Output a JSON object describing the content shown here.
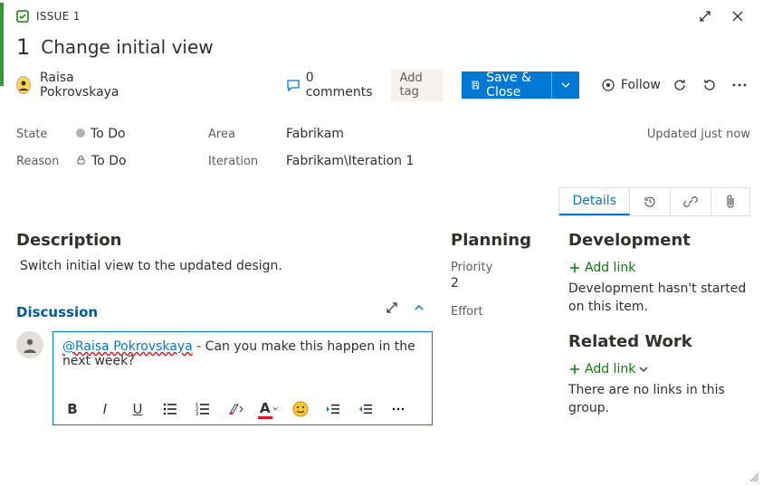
{
  "header": {
    "type_label": "ISSUE 1",
    "id": "1",
    "title": "Change initial view",
    "assignee": "Raisa Pokrovskaya",
    "comments_label": "0 comments",
    "add_tag_label": "Add tag",
    "save_label": "Save & Close",
    "follow_label": "Follow"
  },
  "fields": {
    "state_label": "State",
    "state_value": "To Do",
    "reason_label": "Reason",
    "reason_value": "To Do",
    "area_label": "Area",
    "area_value": "Fabrikam",
    "iteration_label": "Iteration",
    "iteration_value": "Fabrikam\\Iteration 1",
    "updated_label": "Updated just now"
  },
  "tabs": {
    "details": "Details"
  },
  "description": {
    "heading": "Description",
    "text": "Switch initial view to the updated design."
  },
  "discussion": {
    "heading": "Discussion",
    "mention": "@Raisa Pokrovskaya",
    "comment_rest": " - Can you make this happen in the next week?"
  },
  "planning": {
    "heading": "Planning",
    "priority_label": "Priority",
    "priority_value": "2",
    "effort_label": "Effort"
  },
  "development": {
    "heading": "Development",
    "add_link": "Add link",
    "empty": "Development hasn't started on this item."
  },
  "related": {
    "heading": "Related Work",
    "add_link": "Add link",
    "empty": "There are no links in this group."
  }
}
